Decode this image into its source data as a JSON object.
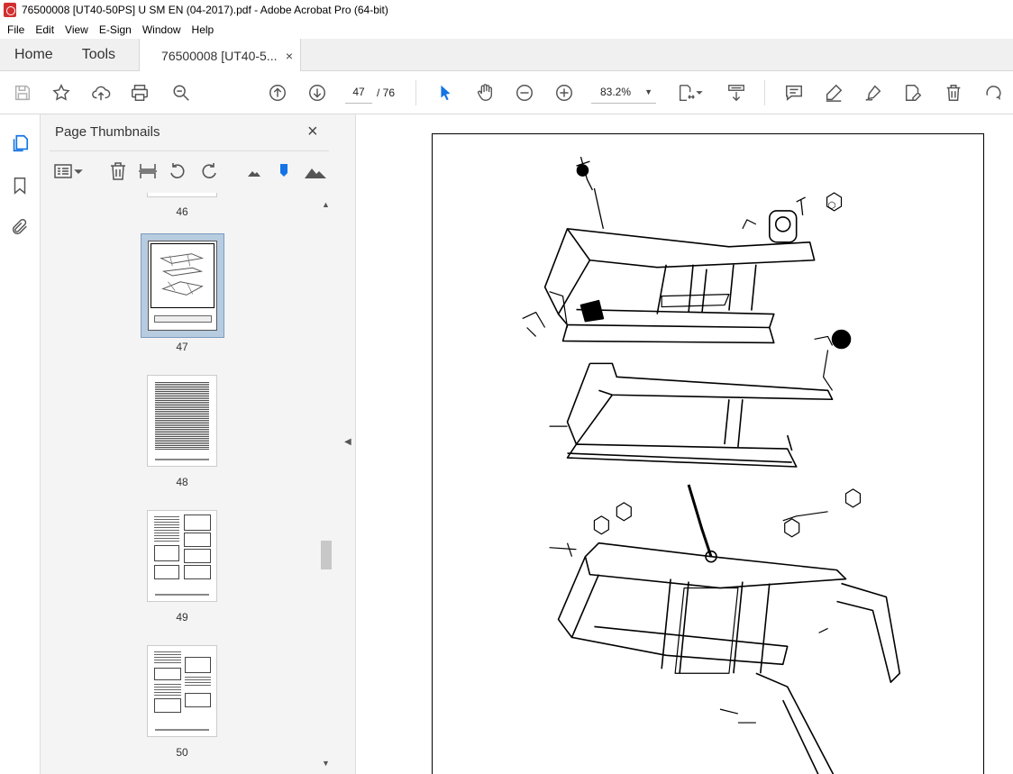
{
  "window": {
    "title": "76500008 [UT40-50PS] U SM EN (04-2017).pdf - Adobe Acrobat Pro (64-bit)"
  },
  "menu": [
    "File",
    "Edit",
    "View",
    "E-Sign",
    "Window",
    "Help"
  ],
  "tabs": {
    "home": "Home",
    "tools": "Tools",
    "doc": "76500008 [UT40-5...",
    "close": "×"
  },
  "toolbar": {
    "page_current": "47",
    "page_total": "/ 76",
    "zoom": "83.2%"
  },
  "panel": {
    "title": "Page Thumbnails",
    "close": "×",
    "thumbnails": [
      {
        "label": "46"
      },
      {
        "label": "47",
        "selected": true
      },
      {
        "label": "48"
      },
      {
        "label": "49"
      },
      {
        "label": "50"
      }
    ]
  },
  "colors": {
    "accent": "#1473e6",
    "selected_thumb": "#b8cce0",
    "toolbar_icon": "#555555"
  }
}
